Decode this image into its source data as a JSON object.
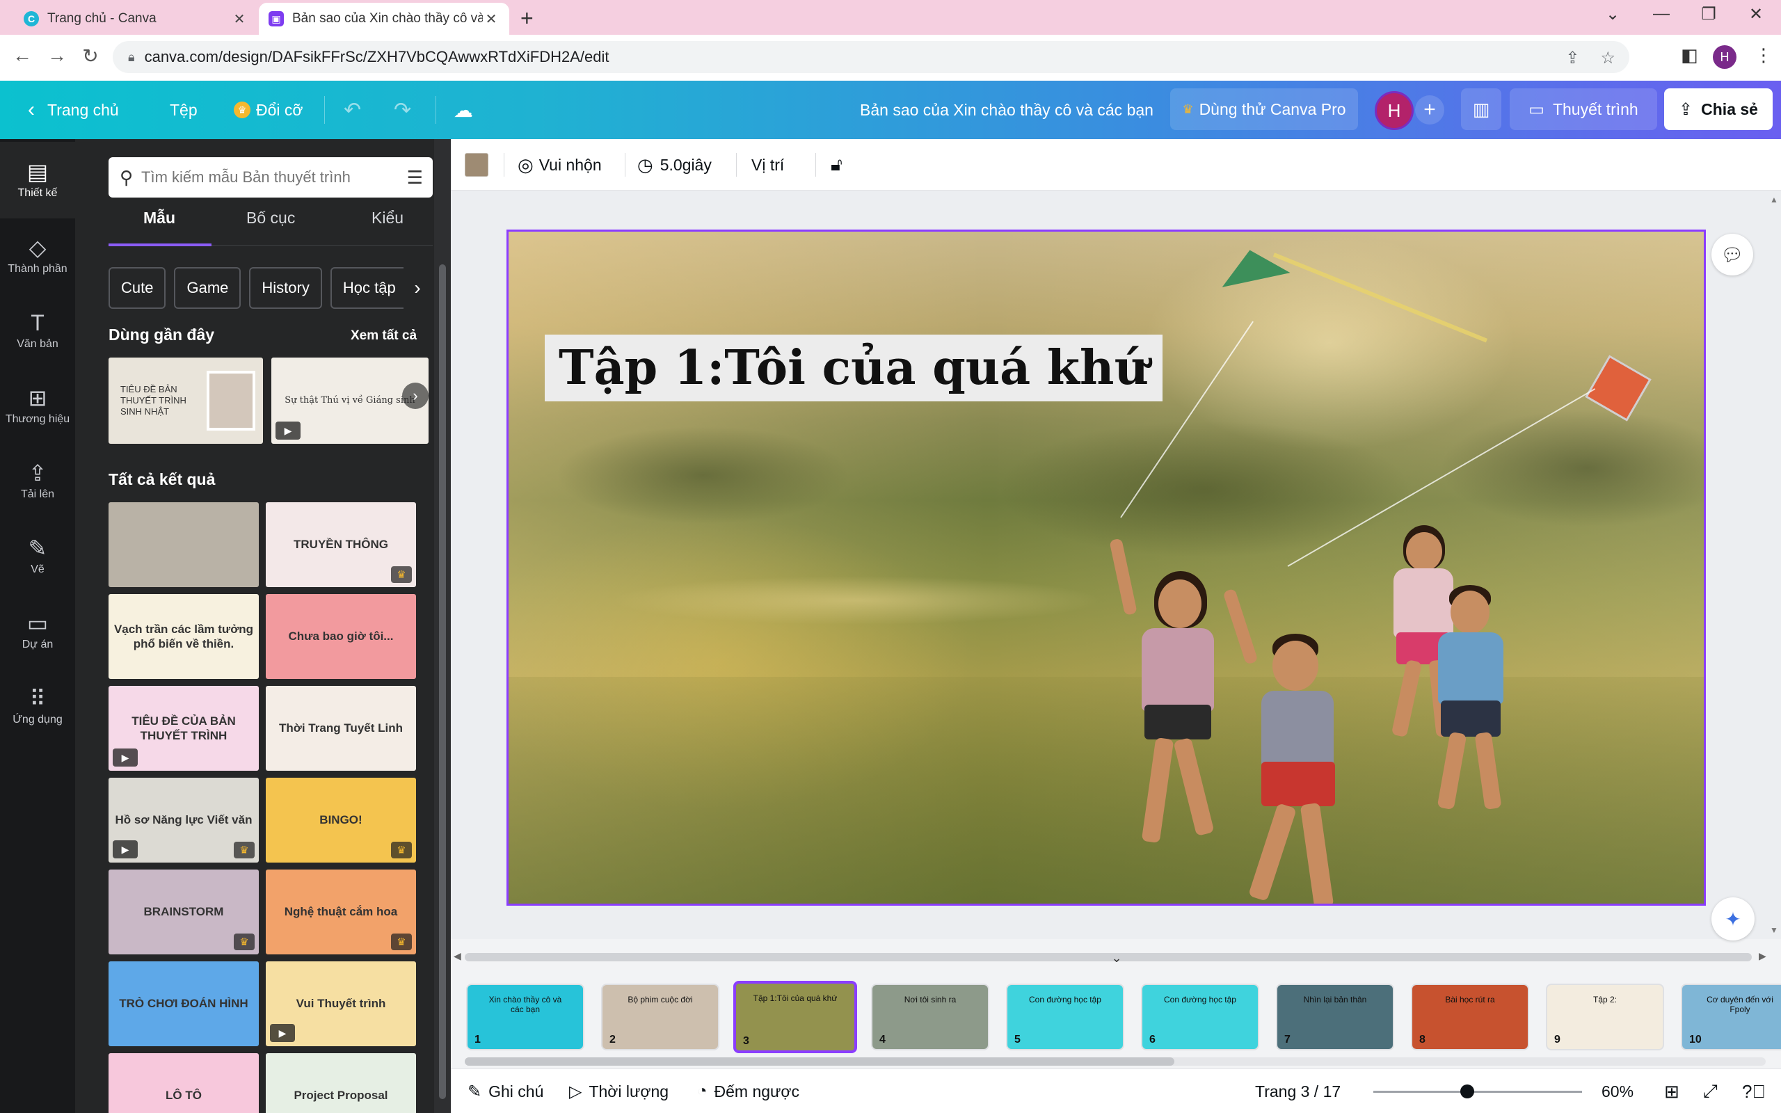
{
  "browser": {
    "tabs": [
      {
        "title": "Trang chủ - Canva",
        "active": false
      },
      {
        "title": "Bản sao của Xin chào thầy cô và các bạn",
        "active": true
      }
    ],
    "url": "canva.com/design/DAFsikFFrSc/ZXH7VbCQAwwxRTdXiFDH2A/edit",
    "profile_initial": "H"
  },
  "header": {
    "home_label": "Trang chủ",
    "file_label": "Tệp",
    "resize_label": "Đổi cỡ",
    "design_title": "Bản sao của Xin chào thầy cô và các bạn",
    "try_pro_label": "Dùng thử Canva Pro",
    "user_initial": "H",
    "present_label": "Thuyết trình",
    "share_label": "Chia sẻ"
  },
  "rail": {
    "items": [
      {
        "label": "Thiết kế",
        "icon": "layout-icon",
        "glyph": "▤",
        "active": true
      },
      {
        "label": "Thành phần",
        "icon": "elements-icon",
        "glyph": "◇",
        "active": false
      },
      {
        "label": "Văn bản",
        "icon": "text-icon",
        "glyph": "T",
        "active": false
      },
      {
        "label": "Thương hiệu",
        "icon": "brand-icon",
        "glyph": "⊞",
        "active": false
      },
      {
        "label": "Tải lên",
        "icon": "upload-icon",
        "glyph": "⇪",
        "active": false
      },
      {
        "label": "Vẽ",
        "icon": "draw-icon",
        "glyph": "✎",
        "active": false
      },
      {
        "label": "Dự án",
        "icon": "folder-icon",
        "glyph": "▭",
        "active": false
      },
      {
        "label": "Ứng dụng",
        "icon": "apps-icon",
        "glyph": "⠿",
        "active": false
      }
    ]
  },
  "panel": {
    "search_placeholder": "Tìm kiếm mẫu Bản thuyết trình",
    "tabs": [
      "Mẫu",
      "Bố cục",
      "Kiểu"
    ],
    "chips": [
      "Cute",
      "Game",
      "History",
      "Học tập"
    ],
    "recent_title": "Dùng gần đây",
    "see_all": "Xem tất cả",
    "recent": [
      {
        "text": "TIÊU ĐỀ BẢN THUYẾT TRÌNH SINH NHẬT",
        "bg": "#e9e4da"
      },
      {
        "text": "Sự thật Thú vị về Giáng sinh",
        "bg": "#f1ede6"
      }
    ],
    "all_title": "Tất cả kết quả",
    "results": [
      {
        "text": "",
        "bg": "#b9b2a6",
        "crown": false,
        "play": false
      },
      {
        "text": "TRUYỀN THÔNG",
        "bg": "#f3e8e8",
        "crown": true,
        "play": false
      },
      {
        "text": "Vạch trần các lầm tưởng phổ biến về thiền.",
        "bg": "#f7f1df",
        "crown": false,
        "play": false
      },
      {
        "text": "Chưa bao giờ tôi...",
        "bg": "#f29a9e",
        "crown": false,
        "play": false
      },
      {
        "text": "TIÊU ĐỀ CỦA BẢN THUYẾT TRÌNH",
        "bg": "#f6d9e8",
        "crown": false,
        "play": true
      },
      {
        "text": "Thời Trang Tuyết Linh",
        "bg": "#f4ede6",
        "crown": false,
        "play": false
      },
      {
        "text": "Hồ sơ Năng lực Viết văn",
        "bg": "#dcdad3",
        "crown": true,
        "play": true
      },
      {
        "text": "BINGO!",
        "bg": "#f4c44f",
        "crown": true,
        "play": false
      },
      {
        "text": "BRAINSTORM",
        "bg": "#c9b8c6",
        "crown": true,
        "play": false
      },
      {
        "text": "Nghệ thuật cắm hoa",
        "bg": "#f2a26a",
        "crown": true,
        "play": false
      },
      {
        "text": "TRÒ CHƠI ĐOÁN HÌNH",
        "bg": "#5ea8e8",
        "crown": false,
        "play": false
      },
      {
        "text": "Vui Thuyết trình",
        "bg": "#f6dfa2",
        "crown": false,
        "play": true
      },
      {
        "text": "LÔ TÔ",
        "bg": "#f7c8dc",
        "crown": false,
        "play": false
      },
      {
        "text": "Project Proposal",
        "bg": "#e6efe4",
        "crown": false,
        "play": false
      }
    ]
  },
  "toolbar": {
    "animation_label": "Vui nhộn",
    "duration_label": "5.0giây",
    "position_label": "Vị trí",
    "swatch_color": "#9e8b73"
  },
  "slide": {
    "title": "Tập 1:Tôi của quá khứ"
  },
  "pages": [
    {
      "num": "1",
      "text": "Xin chào thầy cô và các bạn",
      "bg": "#27c3d9"
    },
    {
      "num": "2",
      "text": "Bộ phim cuộc đời",
      "bg": "#cdbfae"
    },
    {
      "num": "3",
      "text": "Tập 1:Tôi của quá khứ",
      "bg": "#93924e"
    },
    {
      "num": "4",
      "text": "Nơi tôi sinh ra",
      "bg": "#8d9a8a"
    },
    {
      "num": "5",
      "text": "Con đường học tập",
      "bg": "#3fd3dd"
    },
    {
      "num": "6",
      "text": "Con đường học tập",
      "bg": "#3fd3dd"
    },
    {
      "num": "7",
      "text": "Nhìn lại bản thân",
      "bg": "#4c6f7a"
    },
    {
      "num": "8",
      "text": "Bài học rút ra",
      "bg": "#c7522f"
    },
    {
      "num": "9",
      "text": "Tập 2:",
      "bg": "#f3ecdf"
    },
    {
      "num": "10",
      "text": "Cơ duyên đến với Fpoly",
      "bg": "#7fb6d6"
    }
  ],
  "bottom": {
    "notes_label": "Ghi chú",
    "duration_label": "Thời lượng",
    "timer_label": "Đếm ngược",
    "page_indicator": "Trang 3 / 17",
    "zoom_label": "60%",
    "zoom_fraction": 0.45
  }
}
